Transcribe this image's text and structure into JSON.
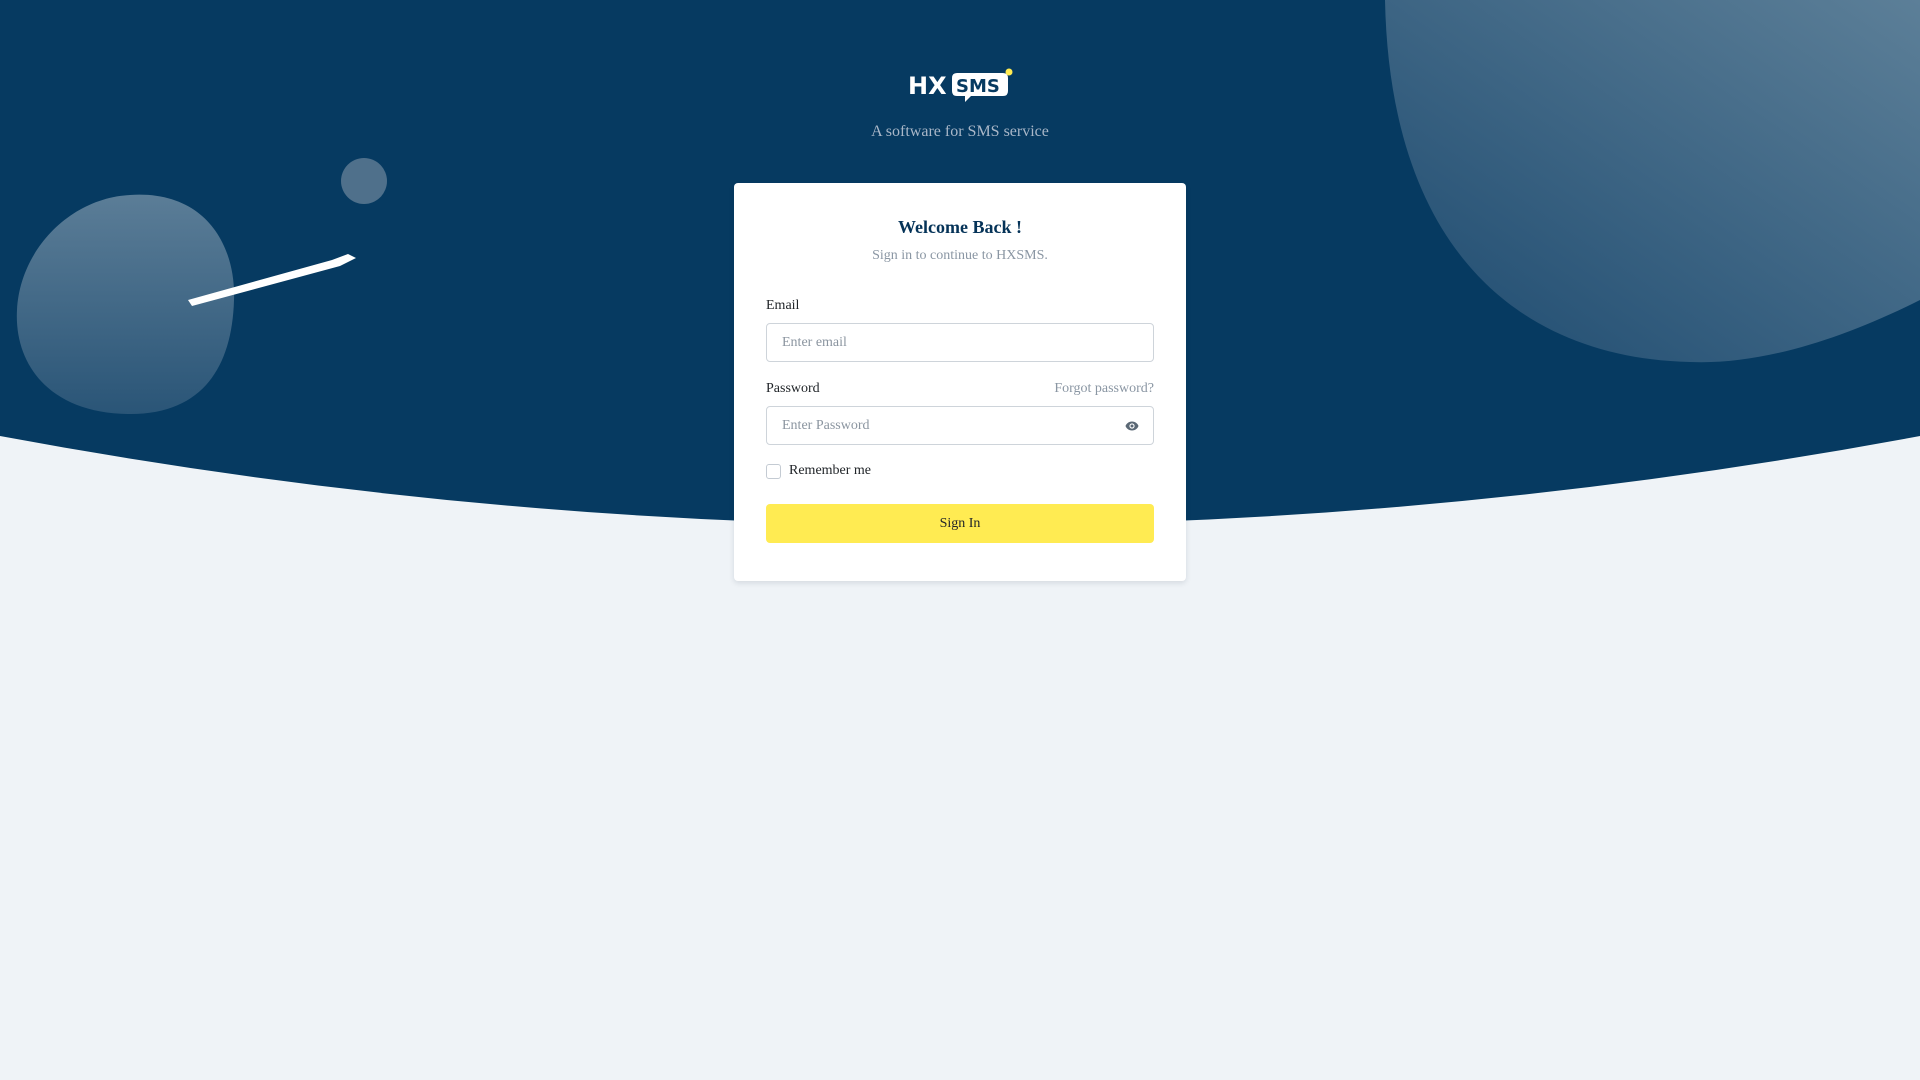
{
  "colors": {
    "header_bg": "#063a61",
    "page_bg": "#eff3f7",
    "accent_yellow": "#ffeb52",
    "title_color": "#053358"
  },
  "brand": {
    "logo_left": "HX",
    "logo_right": "SMS",
    "tagline": "A software for SMS service"
  },
  "login": {
    "title": "Welcome Back !",
    "subtitle": "Sign in to continue to HXSMS.",
    "email_label": "Email",
    "email_placeholder": "Enter email",
    "email_value": "",
    "password_label": "Password",
    "password_placeholder": "Enter Password",
    "password_value": "",
    "forgot_label": "Forgot password?",
    "remember_label": "Remember me",
    "remember_checked": false,
    "submit_label": "Sign In"
  },
  "icons": {
    "password_toggle": "eye-icon",
    "logo_notification_dot": "dot-icon"
  }
}
